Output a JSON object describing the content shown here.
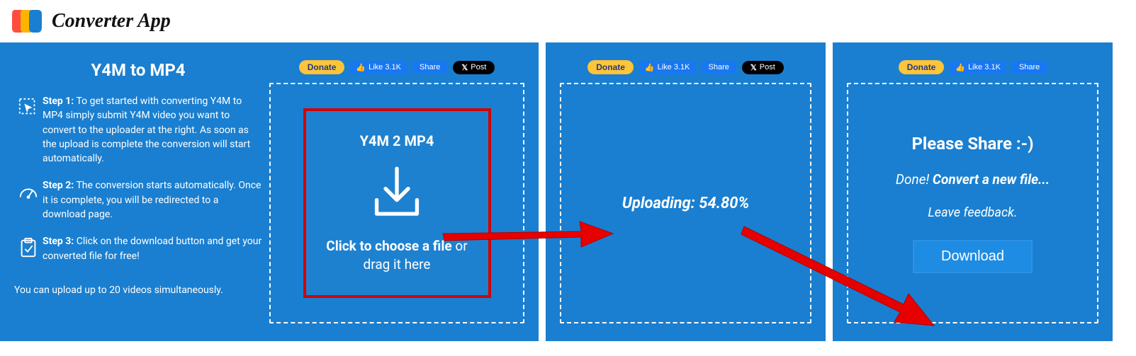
{
  "header": {
    "app_name": "Converter App"
  },
  "info": {
    "title": "Y4M to MP4",
    "step1_label": "Step 1:",
    "step1_text": " To get started with converting Y4M to MP4 simply submit Y4M video you want to convert to the uploader at the right. As soon as the upload is complete the conversion will start automatically.",
    "step2_label": "Step 2:",
    "step2_text": " The conversion starts automatically. Once it is complete, you will be redirected to a download page.",
    "step3_label": "Step 3:",
    "step3_text": " Click on the download button and get your converted file for free!",
    "footnote": "You can upload up to 20 videos simultaneously."
  },
  "social": {
    "donate": "Donate",
    "like": "Like 3.1K",
    "share": "Share",
    "post": "Post"
  },
  "dropzone": {
    "title": "Y4M 2 MP4",
    "cta_bold": "Click to choose a file",
    "cta_rest": " or drag it here"
  },
  "upload": {
    "label": "Uploading: ",
    "percent": "54.80%"
  },
  "done": {
    "share_title": "Please Share :-)",
    "done_prefix": "Done! ",
    "done_link": "Convert a new file...",
    "feedback": "Leave feedback.",
    "download_btn": "Download"
  }
}
